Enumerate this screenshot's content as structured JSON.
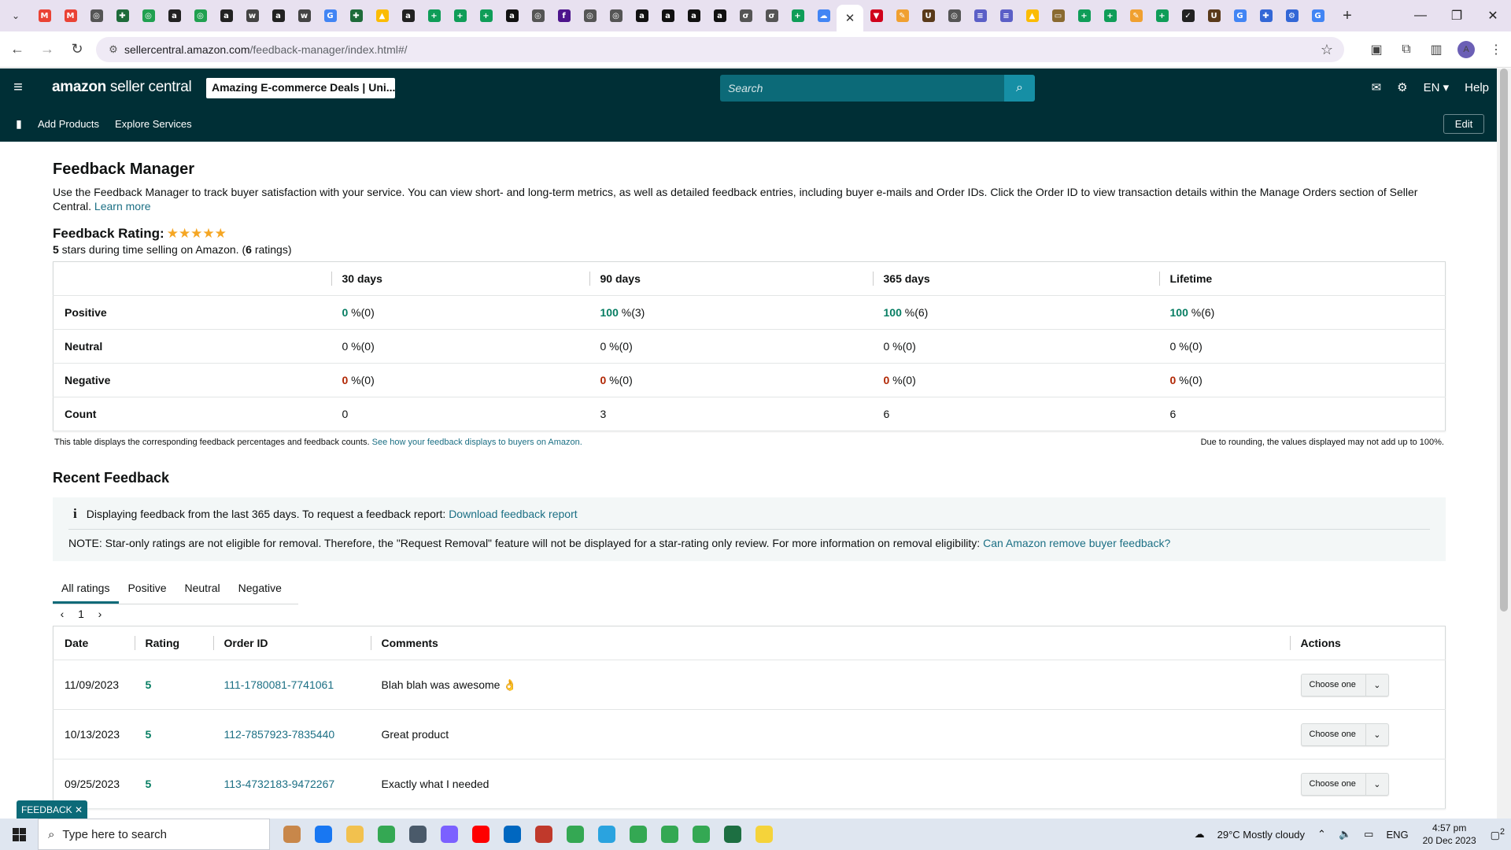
{
  "browser": {
    "url_host": "sellercentral.amazon.com",
    "url_path": "/feedback-manager/index.html#/",
    "tab_favicons": [
      {
        "icon": "gmail-icon",
        "color": "#ea4335",
        "glyph": "M"
      },
      {
        "icon": "gmail-icon",
        "color": "#ea4335",
        "glyph": "M"
      },
      {
        "icon": "globe-icon",
        "color": "#555555",
        "glyph": "◎"
      },
      {
        "icon": "puzzle-icon",
        "color": "#1e6b3a",
        "glyph": "✚"
      },
      {
        "icon": "circle-icon",
        "color": "#20a050",
        "glyph": "◎"
      },
      {
        "icon": "amazon-icon",
        "color": "#222222",
        "glyph": "a"
      },
      {
        "icon": "circle-icon",
        "color": "#20a050",
        "glyph": "◎"
      },
      {
        "icon": "amazon-icon",
        "color": "#222222",
        "glyph": "a"
      },
      {
        "icon": "wix-icon",
        "color": "#444444",
        "glyph": "w"
      },
      {
        "icon": "amazon-icon",
        "color": "#222222",
        "glyph": "a"
      },
      {
        "icon": "wix-icon",
        "color": "#444444",
        "glyph": "w"
      },
      {
        "icon": "google-icon",
        "color": "#4285f4",
        "glyph": "G"
      },
      {
        "icon": "puzzle-icon",
        "color": "#1e6b3a",
        "glyph": "✚"
      },
      {
        "icon": "drive-icon",
        "color": "#fbbc04",
        "glyph": "▲"
      },
      {
        "icon": "amazon-icon",
        "color": "#222222",
        "glyph": "a"
      },
      {
        "icon": "sheets-icon",
        "color": "#0f9d58",
        "glyph": "+"
      },
      {
        "icon": "sheets-icon",
        "color": "#0f9d58",
        "glyph": "+"
      },
      {
        "icon": "sheets-icon",
        "color": "#0f9d58",
        "glyph": "+"
      },
      {
        "icon": "amazon-icon",
        "color": "#111111",
        "glyph": "a"
      },
      {
        "icon": "globe-icon",
        "color": "#555555",
        "glyph": "◎"
      },
      {
        "icon": "fedex-icon",
        "color": "#4d148c",
        "glyph": "f"
      },
      {
        "icon": "globe-icon",
        "color": "#555555",
        "glyph": "◎"
      },
      {
        "icon": "globe-icon",
        "color": "#555555",
        "glyph": "◎"
      },
      {
        "icon": "amazon-icon",
        "color": "#111111",
        "glyph": "a"
      },
      {
        "icon": "amazon-icon",
        "color": "#111111",
        "glyph": "a"
      },
      {
        "icon": "amazon-icon",
        "color": "#111111",
        "glyph": "a"
      },
      {
        "icon": "amazon-icon",
        "color": "#111111",
        "glyph": "a"
      },
      {
        "icon": "tool-icon",
        "color": "#555555",
        "glyph": "σ"
      },
      {
        "icon": "tool-icon",
        "color": "#555555",
        "glyph": "σ"
      },
      {
        "icon": "sheets-icon",
        "color": "#0f9d58",
        "glyph": "+"
      },
      {
        "icon": "cloud-icon",
        "color": "#4285f4",
        "glyph": "☁"
      }
    ],
    "tab_favicons_after": [
      {
        "icon": "vpn-icon",
        "color": "#d0021b",
        "glyph": "▼"
      },
      {
        "icon": "pencil-icon",
        "color": "#f0a030",
        "glyph": "✎"
      },
      {
        "icon": "ups-icon",
        "color": "#5a3a1a",
        "glyph": "U"
      },
      {
        "icon": "globe-icon",
        "color": "#555555",
        "glyph": "◎"
      },
      {
        "icon": "list-icon",
        "color": "#5b5fc7",
        "glyph": "≡"
      },
      {
        "icon": "list-icon",
        "color": "#5b5fc7",
        "glyph": "≡"
      },
      {
        "icon": "drive-icon",
        "color": "#fbbc04",
        "glyph": "▲"
      },
      {
        "icon": "tool-icon",
        "color": "#8a6a30",
        "glyph": "▭"
      },
      {
        "icon": "sheets-icon",
        "color": "#0f9d58",
        "glyph": "+"
      },
      {
        "icon": "sheets-icon",
        "color": "#0f9d58",
        "glyph": "+"
      },
      {
        "icon": "pencil-icon",
        "color": "#f0a030",
        "glyph": "✎"
      },
      {
        "icon": "sheets-icon",
        "color": "#0f9d58",
        "glyph": "+"
      },
      {
        "icon": "check-icon",
        "color": "#222222",
        "glyph": "✓"
      },
      {
        "icon": "ups-icon",
        "color": "#5a3a1a",
        "glyph": "U"
      },
      {
        "icon": "google-icon",
        "color": "#4285f4",
        "glyph": "G"
      },
      {
        "icon": "puzzle-icon",
        "color": "#3367d6",
        "glyph": "✚"
      },
      {
        "icon": "gear-icon",
        "color": "#3367d6",
        "glyph": "⚙"
      },
      {
        "icon": "google-icon",
        "color": "#4285f4",
        "glyph": "G"
      }
    ],
    "profile_initial": "A"
  },
  "header": {
    "logo_bold": "amazon",
    "logo_rest": " seller central",
    "store_selector": "Amazing E-commerce Deals | Uni...",
    "search_placeholder": "Search",
    "language": "EN",
    "help": "Help",
    "nav_links": [
      "Add Products",
      "Explore Services"
    ],
    "edit": "Edit"
  },
  "page": {
    "title": "Feedback Manager",
    "description": "Use the Feedback Manager to track buyer satisfaction with your service. You can view short- and long-term metrics, as well as detailed feedback entries, including buyer e-mails and Order IDs. Click the Order ID to view transaction details within the Manage Orders section of Seller Central.",
    "learn_more": "Learn more",
    "rating_label": "Feedback Rating:",
    "stars": "★★★★★",
    "rating_stars_value": "5",
    "rating_sub_mid": " stars during time selling on Amazon. (",
    "rating_count": "6",
    "rating_sub_end": " ratings)"
  },
  "metrics": {
    "columns": [
      "30 days",
      "90 days",
      "365 days",
      "Lifetime"
    ],
    "rows": {
      "positive": {
        "label": "Positive",
        "cells": [
          [
            "0",
            " %(0)"
          ],
          [
            "100",
            " %(3)"
          ],
          [
            "100",
            " %(6)"
          ],
          [
            "100",
            " %(6)"
          ]
        ]
      },
      "neutral": {
        "label": "Neutral",
        "cells": [
          [
            "0",
            " %(0)"
          ],
          [
            "0",
            " %(0)"
          ],
          [
            "0",
            " %(0)"
          ],
          [
            "0",
            " %(0)"
          ]
        ]
      },
      "negative": {
        "label": "Negative",
        "cells": [
          [
            "0",
            " %(0)"
          ],
          [
            "0",
            " %(0)"
          ],
          [
            "0",
            " %(0)"
          ],
          [
            "0",
            " %(0)"
          ]
        ]
      },
      "count": {
        "label": "Count",
        "cells": [
          "0",
          "3",
          "6",
          "6"
        ]
      }
    },
    "footnote_left": "This table displays the corresponding feedback percentages and feedback counts.",
    "footnote_link": "See how your feedback displays to buyers on Amazon.",
    "footnote_right": "Due to rounding, the values displayed may not add up to 100%."
  },
  "recent": {
    "title": "Recent Feedback",
    "info_text": "Displaying feedback from the last 365 days. To request a feedback report:",
    "info_link": "Download feedback report",
    "note_text": "NOTE: Star-only ratings are not eligible for removal. Therefore, the \"Request Removal\" feature will not be displayed for a star-rating only review. For more information on removal eligibility:",
    "note_link": "Can Amazon remove buyer feedback?",
    "filter_tabs": [
      "All ratings",
      "Positive",
      "Neutral",
      "Negative"
    ],
    "page_number": "1",
    "columns": [
      "Date",
      "Rating",
      "Order ID",
      "Comments",
      "Actions"
    ],
    "rows": [
      {
        "date": "11/09/2023",
        "rating": "5",
        "order_id": "111-1780081-7741061",
        "comment": "Blah blah was awesome",
        "emoji": "👌",
        "action": "Choose one"
      },
      {
        "date": "10/13/2023",
        "rating": "5",
        "order_id": "112-7857923-7835440",
        "comment": "Great product",
        "emoji": "",
        "action": "Choose one"
      },
      {
        "date": "09/25/2023",
        "rating": "5",
        "order_id": "113-4732183-9472267",
        "comment": "Exactly what I needed",
        "emoji": "",
        "action": "Choose one"
      }
    ]
  },
  "feedback_tab": "FEEDBACK",
  "taskbar": {
    "search_placeholder": "Type here to search",
    "weather": "29°C  Mostly cloudy",
    "lang": "ENG",
    "time": "4:57 pm",
    "date": "20 Dec 2023",
    "notification_count": "2",
    "apps": [
      {
        "icon": "village-icon",
        "color": "#c8874a"
      },
      {
        "icon": "facebook-icon",
        "color": "#1877f2"
      },
      {
        "icon": "file-explorer-icon",
        "color": "#f2c14e"
      },
      {
        "icon": "chrome-icon",
        "color": "#34a853"
      },
      {
        "icon": "calculator-icon",
        "color": "#4a5a6a"
      },
      {
        "icon": "copilot-icon",
        "color": "#7b61ff"
      },
      {
        "icon": "youtube-icon",
        "color": "#ff0000"
      },
      {
        "icon": "store-icon",
        "color": "#0067c0"
      },
      {
        "icon": "snipping-icon",
        "color": "#c0392b"
      },
      {
        "icon": "chrome-icon",
        "color": "#34a853"
      },
      {
        "icon": "telegram-icon",
        "color": "#2aa3df"
      },
      {
        "icon": "chrome-icon",
        "color": "#34a853"
      },
      {
        "icon": "chrome-icon",
        "color": "#34a853"
      },
      {
        "icon": "chrome-icon",
        "color": "#34a853"
      },
      {
        "icon": "excel-icon",
        "color": "#1d6f42"
      },
      {
        "icon": "sticky-notes-icon",
        "color": "#f5d33a"
      }
    ]
  }
}
